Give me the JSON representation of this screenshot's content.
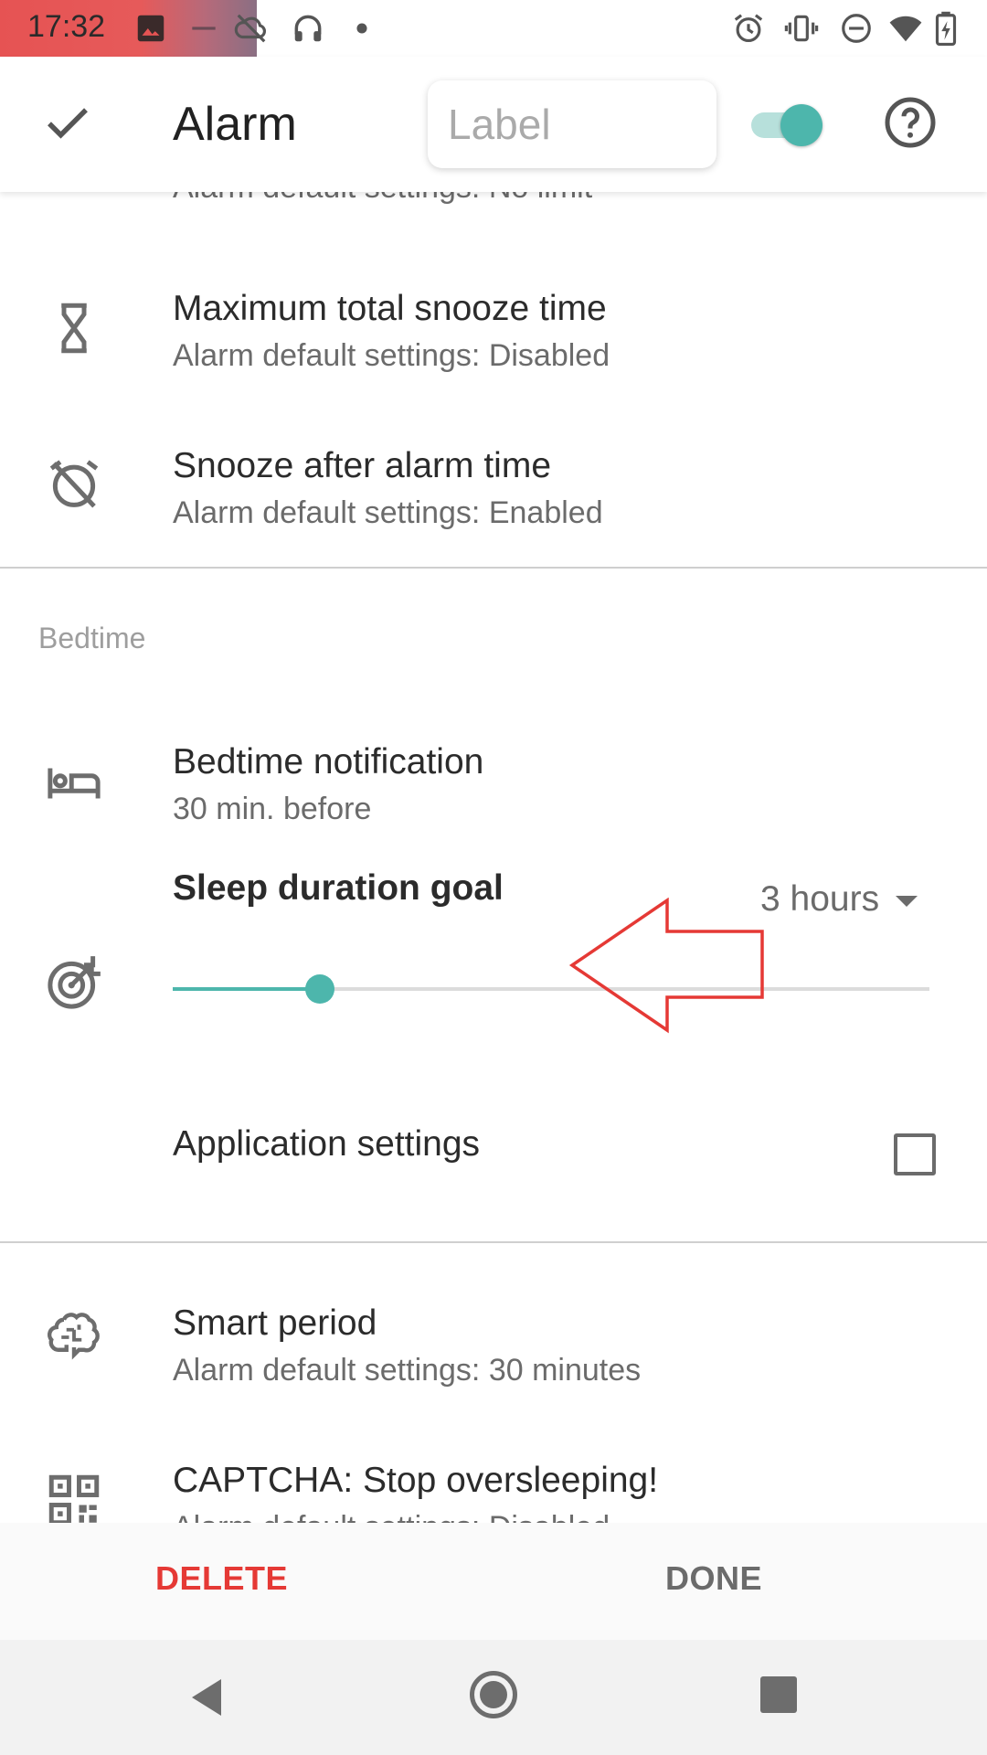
{
  "status_bar": {
    "time": "17:32",
    "icons": [
      "image-icon",
      "minus-icon",
      "cloud-off-icon",
      "headphones-icon",
      "dot-icon",
      "alarm-icon",
      "vibrate-icon",
      "do-not-disturb-icon",
      "wifi-icon",
      "battery-charging-icon"
    ]
  },
  "app_bar": {
    "title": "Alarm",
    "label_placeholder": "Label",
    "enabled": true
  },
  "rows": {
    "partial_sub": "Alarm default settings: No limit",
    "max_snooze": {
      "title": "Maximum total snooze time",
      "subtitle": "Alarm default settings: Disabled",
      "icon": "hourglass-icon"
    },
    "snooze_after": {
      "title": "Snooze after alarm time",
      "subtitle": "Alarm default settings: Enabled",
      "icon": "alarm-off-icon"
    },
    "bedtime_section": "Bedtime",
    "bedtime_notification": {
      "title": "Bedtime notification",
      "subtitle": "30 min. before",
      "icon": "bed-icon"
    },
    "sleep_goal": {
      "title": "Sleep duration goal",
      "value": "3 hours",
      "slider_fraction": 0.195,
      "icon": "target-icon"
    },
    "app_settings": {
      "title": "Application settings",
      "checked": false
    },
    "smart_period": {
      "title": "Smart period",
      "subtitle": "Alarm default settings: 30 minutes",
      "icon": "brain-icon"
    },
    "captcha": {
      "title": "CAPTCHA: Stop oversleeping!",
      "subtitle": "Alarm default settings: Disabled",
      "icon": "qr-code-icon"
    }
  },
  "actions": {
    "delete": "DELETE",
    "done": "DONE"
  },
  "colors": {
    "accent": "#4db6ac",
    "delete": "#e53935",
    "annotation": "#e53935"
  }
}
